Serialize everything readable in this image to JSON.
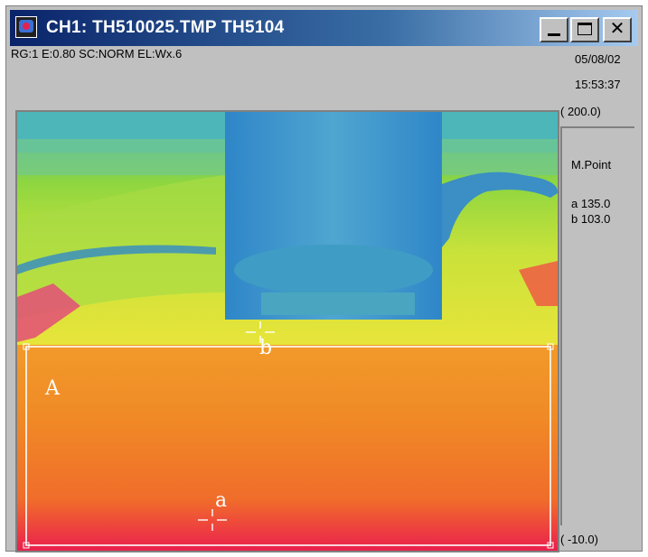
{
  "window": {
    "title": "CH1: TH510025.TMP  TH5104",
    "icon": "thermal-camera-icon",
    "controls": {
      "minimize": "minimize-icon",
      "maximize": "maximize-icon",
      "close": "close-icon"
    }
  },
  "status": {
    "params": "RG:1  E:0.80  SC:NORM EL:Wx.6",
    "date": "05/08/02",
    "time": "15:53:37"
  },
  "scale": {
    "top": "( 200.0)",
    "bottom": "( -10.0)"
  },
  "measure": {
    "title": "M.Point",
    "points": [
      {
        "label": "a 135.0"
      },
      {
        "label": "b 103.0"
      }
    ]
  },
  "overlay": {
    "region_label": "A",
    "point_a": "a",
    "point_b": "b"
  },
  "colors": {
    "titlebar": "#0a246a",
    "window": "#c0c0c0",
    "hot": "#e8204c",
    "cool": "#3a8cc8"
  }
}
